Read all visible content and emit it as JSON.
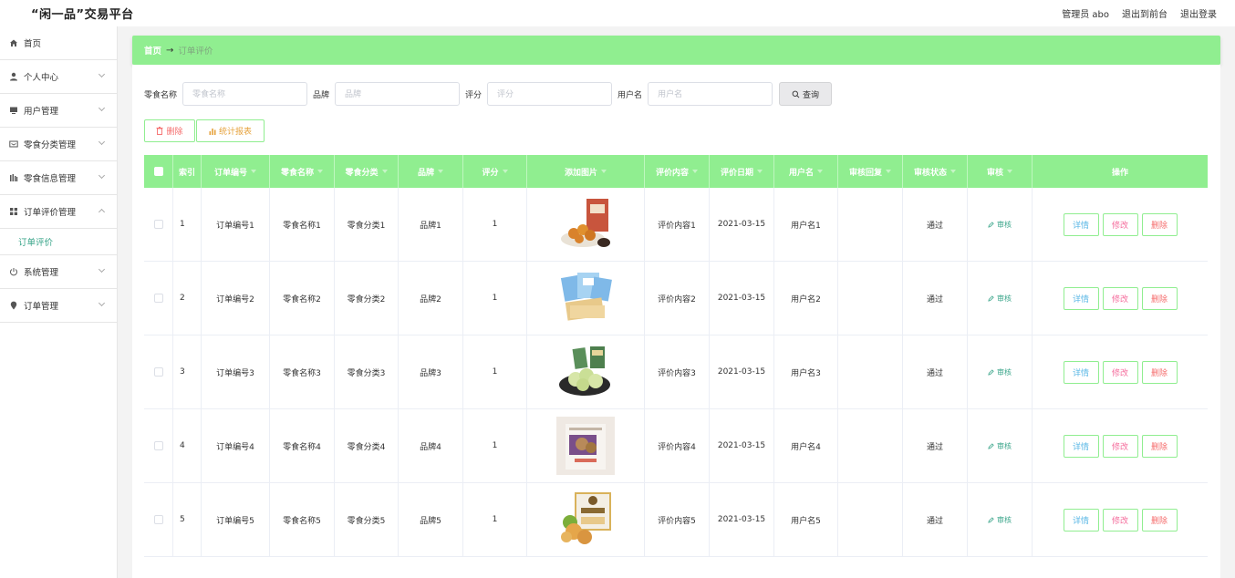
{
  "app": {
    "title": "“闲一品”交易平台",
    "user_label": "管理员 abo",
    "back_label": "退出到前台",
    "logout_label": "退出登录"
  },
  "sidebar": {
    "items": [
      {
        "label": "首页",
        "icon": "home-icon"
      },
      {
        "label": "个人中心",
        "icon": "user-icon"
      },
      {
        "label": "用户管理",
        "icon": "monitor-icon"
      },
      {
        "label": "零食分类管理",
        "icon": "envelope-icon"
      },
      {
        "label": "零食信息管理",
        "icon": "bars-icon"
      },
      {
        "label": "订单评价管理",
        "icon": "grid-icon"
      },
      {
        "label": "系统管理",
        "icon": "power-icon"
      },
      {
        "label": "订单管理",
        "icon": "pin-icon"
      }
    ],
    "sub_active": "订单评价"
  },
  "breadcrumb": {
    "home": "首页",
    "arrow": "→",
    "current": "订单评价"
  },
  "search": {
    "fields": [
      {
        "label": "零食名称",
        "placeholder": "零食名称"
      },
      {
        "label": "品牌",
        "placeholder": "品牌"
      },
      {
        "label": "评分",
        "placeholder": "评分"
      },
      {
        "label": "用户名",
        "placeholder": "用户名"
      }
    ],
    "button": "查询"
  },
  "actions": {
    "delete": "删除",
    "stats": "统计报表"
  },
  "table": {
    "headers": [
      "索引",
      "订单编号",
      "零食名称",
      "零食分类",
      "品牌",
      "评分",
      "添加图片",
      "评价内容",
      "评价日期",
      "用户名",
      "审核回复",
      "审核状态",
      "审核",
      "操作"
    ],
    "audit_label": "审核",
    "op_detail": "详情",
    "op_edit": "修改",
    "op_delete": "删除",
    "rows": [
      {
        "index": "1",
        "order_no": "订单编号1",
        "name": "零食名称1",
        "category": "零食分类1",
        "brand": "品牌1",
        "score": "1",
        "content": "评价内容1",
        "date": "2021-03-15",
        "user": "用户名1",
        "reply": "",
        "status": "通过"
      },
      {
        "index": "2",
        "order_no": "订单编号2",
        "name": "零食名称2",
        "category": "零食分类2",
        "brand": "品牌2",
        "score": "1",
        "content": "评价内容2",
        "date": "2021-03-15",
        "user": "用户名2",
        "reply": "",
        "status": "通过"
      },
      {
        "index": "3",
        "order_no": "订单编号3",
        "name": "零食名称3",
        "category": "零食分类3",
        "brand": "品牌3",
        "score": "1",
        "content": "评价内容3",
        "date": "2021-03-15",
        "user": "用户名3",
        "reply": "",
        "status": "通过"
      },
      {
        "index": "4",
        "order_no": "订单编号4",
        "name": "零食名称4",
        "category": "零食分类4",
        "brand": "品牌4",
        "score": "1",
        "content": "评价内容4",
        "date": "2021-03-15",
        "user": "用户名4",
        "reply": "",
        "status": "通过"
      },
      {
        "index": "5",
        "order_no": "订单编号5",
        "name": "零食名称5",
        "category": "零食分类5",
        "brand": "品牌5",
        "score": "1",
        "content": "评价内容5",
        "date": "2021-03-15",
        "user": "用户名5",
        "reply": "",
        "status": "通过"
      }
    ]
  },
  "colors": {
    "accent": "#90ee90",
    "active_text": "#3aa58a",
    "danger": "#f56c6c",
    "warning": "#e6a23c"
  }
}
